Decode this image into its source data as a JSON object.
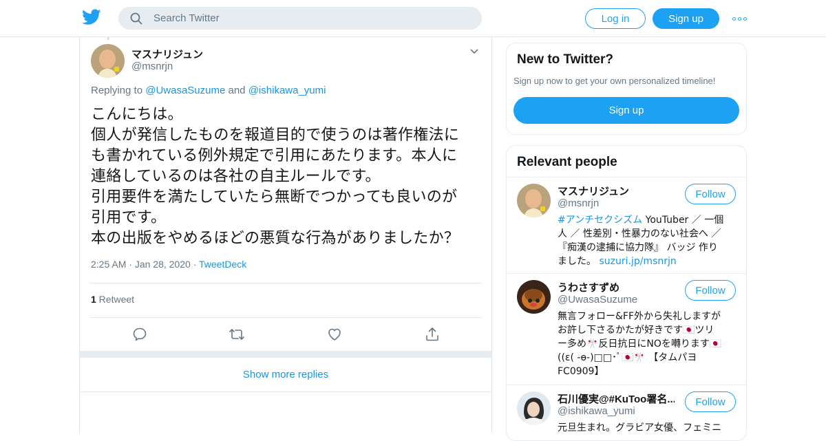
{
  "header": {
    "logo_icon": "twitter-bird-icon",
    "search_placeholder": "Search Twitter",
    "login_label": "Log in",
    "signup_label": "Sign up",
    "more_icon": "more-dots-icon",
    "accent": "#1da1f2"
  },
  "tweet": {
    "author_name": "マスナリジュン",
    "author_handle": "@msnrjn",
    "replying_prefix": "Replying to ",
    "replying_user1": "@UwasaSuzume",
    "replying_and": " and ",
    "replying_user2": "@ishikawa_yumi",
    "text_lines": [
      "こんにちは。",
      "個人が発信したものを報道目的で使うのは著作権法に",
      "も書かれている例外規定で引用にあたります。本人に",
      "連絡しているのは各社の自主ルールです。",
      "引用要件を満たしていたら無断でつかっても良いのが",
      "引用です。",
      "本の出版をやめるほどの悪質な行為がありましたか？"
    ],
    "time": "2:25 AM",
    "date": "Jan 28, 2020",
    "source": "TweetDeck",
    "retweet_count": "1",
    "retweet_label": " Retweet",
    "actions": [
      "reply-icon",
      "retweet-icon",
      "like-icon",
      "share-icon"
    ],
    "show_more": "Show more replies"
  },
  "sidebar": {
    "new_title": "New to Twitter?",
    "new_subtitle": "Sign up now to get your own personalized timeline!",
    "new_signup_label": "Sign up",
    "people_title": "Relevant people",
    "follow_label": "Follow",
    "people": [
      {
        "name": "マスナリジュン",
        "handle": "@msnrjn",
        "bio_lines": [
          [
            "#アンチセクシズム",
            " YouTuber ／ 一個"
          ],
          [
            "人 ／ 性差別・性暴力のない社会へ ／"
          ],
          [
            "『痴漢の逮捕に協力隊』 バッジ 作り"
          ],
          [
            "ました。 ",
            "suzuri.jp/msnrjn"
          ]
        ]
      },
      {
        "name": "うわさすずめ",
        "handle": "@UwasaSuzume",
        "bio_lines": [
          [
            "無言フォロー&FF外から失礼しますが"
          ],
          [
            "お許し下さるかたが好きです🇯🇵ツリ"
          ],
          [
            "ー多め🎌反日抗日にNOを囀ります🇯🇵"
          ],
          [
            "((ε( -ө-)□□･ﾟ🇯🇵🎌 【タムパヨ"
          ],
          [
            "FC0909】"
          ]
        ]
      },
      {
        "name": "石川優実@#KuToo署名...",
        "handle": "@ishikawa_yumi",
        "bio_lines": [
          [
            "元旦生まれ。グラビア女優、フェミニ"
          ]
        ]
      }
    ]
  }
}
